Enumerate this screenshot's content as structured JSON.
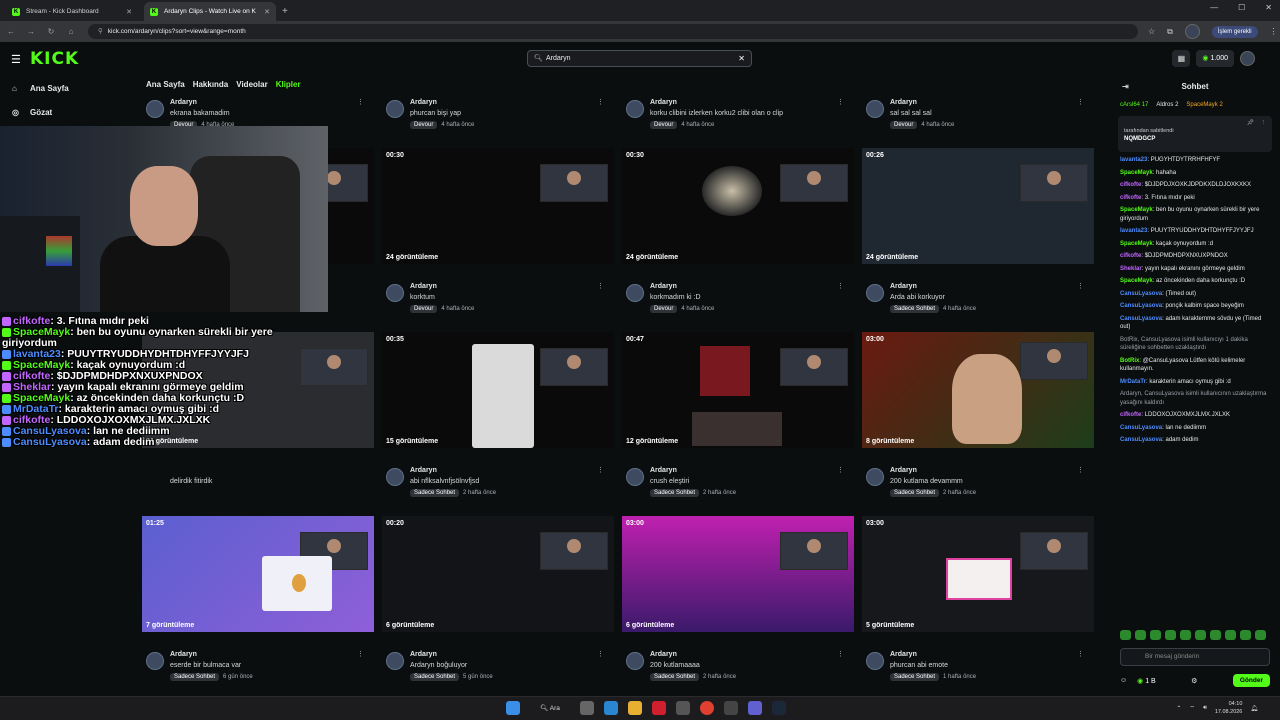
{
  "browser": {
    "tabs": [
      {
        "title": "Stream - Kick Dashboard"
      },
      {
        "title": "Ardaryn Clips - Watch Live on K"
      }
    ],
    "url": "kick.com/ardaryn/clips?sort=view&range=month",
    "update_label": "İşlem gerekli"
  },
  "header": {
    "logo": "KICK",
    "search_value": "Ardaryn",
    "kicks_count": "1.000"
  },
  "sidebar": {
    "items": [
      {
        "label": "Ana Sayfa",
        "icon": "home-icon"
      },
      {
        "label": "Gözat",
        "icon": "compass-icon"
      }
    ]
  },
  "channel_tabs": [
    "Ana Sayfa",
    "Hakkında",
    "Videolar",
    "Klipler"
  ],
  "clips_top_row": [
    {
      "author": "Ardaryn",
      "title": "ekrana bakamadim",
      "category": "Devour",
      "age": "4 hafta önce"
    },
    {
      "author": "Ardaryn",
      "title": "phurcan bişi yap",
      "category": "Devour",
      "age": "4 hafta önce"
    },
    {
      "author": "Ardaryn",
      "title": "korku clibini izlerken korku2 clibi olan o clip",
      "category": "Devour",
      "age": "4 hafta önce"
    },
    {
      "author": "Ardaryn",
      "title": "sal sal sal sal",
      "category": "Devour",
      "age": "4 hafta önce"
    }
  ],
  "clips": [
    [
      {
        "duration": "",
        "views": "",
        "author": "",
        "title": "",
        "category": "",
        "age": ""
      },
      {
        "duration": "00:30",
        "views": "24 görüntüleme",
        "author": "Ardaryn",
        "title": "korktum",
        "category": "Devour",
        "age": "4 hafta önce"
      },
      {
        "duration": "00:30",
        "views": "24 görüntüleme",
        "author": "Ardaryn",
        "title": "korkmadım ki :D",
        "category": "Devour",
        "age": "4 hafta önce"
      },
      {
        "duration": "00:26",
        "views": "24 görüntüleme",
        "author": "Ardaryn",
        "title": "Arda abi korkuyor",
        "category": "Sadece Sohbet",
        "age": "4 hafta önce"
      }
    ],
    [
      {
        "duration": "",
        "views": "23 görüntüleme",
        "author": "",
        "title": "delirdik fitirdik",
        "category": "",
        "age": ""
      },
      {
        "duration": "00:35",
        "views": "15 görüntüleme",
        "author": "Ardaryn",
        "title": "abi nflksalvnfjsölnvfjsd",
        "category": "Sadece Sohbet",
        "age": "2 hafta önce"
      },
      {
        "duration": "00:47",
        "views": "12 görüntüleme",
        "author": "Ardaryn",
        "title": "crush eleştiri",
        "category": "Sadece Sohbet",
        "age": "2 hafta önce"
      },
      {
        "duration": "03:00",
        "views": "8 görüntüleme",
        "author": "Ardaryn",
        "title": "200 kutlama devammm",
        "category": "Sadece Sohbet",
        "age": "2 hafta önce"
      }
    ],
    [
      {
        "duration": "01:25",
        "views": "7 görüntüleme",
        "author": "Ardaryn",
        "title": "eserde bir bulmaca var",
        "category": "Sadece Sohbet",
        "age": "6 gün önce"
      },
      {
        "duration": "00:20",
        "views": "6 görüntüleme",
        "author": "Ardaryn",
        "title": "Ardaryn boğuluyor",
        "category": "Sadece Sohbet",
        "age": "5 gün önce"
      },
      {
        "duration": "03:00",
        "views": "6 görüntüleme",
        "author": "Ardaryn",
        "title": "200 kutlamaaaa",
        "category": "Sadece Sohbet",
        "age": "2 hafta önce"
      },
      {
        "duration": "03:00",
        "views": "5 görüntüleme",
        "author": "Ardaryn",
        "title": "phurcan abi emote",
        "category": "Sadece Sohbet",
        "age": "1 hafta önce"
      }
    ]
  ],
  "chat": {
    "title": "Sohbet",
    "gifters": [
      {
        "name": "cArsl64",
        "count": "17"
      },
      {
        "name": "Aldros",
        "count": "2"
      },
      {
        "name": "SpaceMayk",
        "count": "2"
      }
    ],
    "pinned_by": "tarafından sabitlendi",
    "pinned_msg": "NQMDGCP",
    "messages": [
      {
        "user": "lavanta23",
        "color": "#4d8cff",
        "text": "PUGYHTDYTRRHFHFYF"
      },
      {
        "user": "SpaceMayk",
        "color": "#53fc18",
        "text": "hahaha"
      },
      {
        "user": "cifkofte",
        "color": "#c266ff",
        "text": "$DJDPDJXOXKJDPDKXDLDJOXKXKX"
      },
      {
        "user": "cifkofte",
        "color": "#c266ff",
        "text": "3. Fıtına mıdır peki"
      },
      {
        "user": "SpaceMayk",
        "color": "#53fc18",
        "text": "ben bu oyunu oynarken sürekli bir yere giriyordum"
      },
      {
        "user": "lavanta23",
        "color": "#4d8cff",
        "text": "PUUYTRYUDDHYDHTDHYFFJYYJFJ"
      },
      {
        "user": "SpaceMayk",
        "color": "#53fc18",
        "text": "kaçak oynuyordum :d"
      },
      {
        "user": "cifkofte",
        "color": "#c266ff",
        "text": "$DJDPMDHDPXNXUXPNDOX"
      },
      {
        "user": "Sheklar",
        "color": "#c266ff",
        "text": "yayın kapalı ekranını görmeye geldim"
      },
      {
        "user": "SpaceMayk",
        "color": "#53fc18",
        "text": "az öncekinden daha korkunçtu :D"
      },
      {
        "user": "CansuLyasova",
        "color": "#4d8cff",
        "text": "(Timed out)"
      },
      {
        "user": "CansuLyasova",
        "color": "#4d8cff",
        "text": "ponçik kalbim space beyeğim"
      },
      {
        "user": "CansuLyasova",
        "color": "#4d8cff",
        "text": "adam karakternme sövdu ye (Timed out)"
      },
      {
        "user": "",
        "color": "#9aa0a6",
        "text": "BotRix, CansuLyasova isimli kullanıcıyı 1 dakika süreliğine sohbetten uzaklaştırdı"
      },
      {
        "user": "BotRix",
        "color": "#53fc18",
        "text": "@CansuLyasova Lütfen kötü kelimeler kullanmayın."
      },
      {
        "user": "MrDataTr",
        "color": "#4d8cff",
        "text": "karakterin amacı oymuş gibi :d"
      },
      {
        "user": "",
        "color": "#9aa0a6",
        "text": "Ardaryn, CansuLyasova isimli kullanıcının uzaklaştırma yasağını kaldırdı"
      },
      {
        "user": "cifkofte",
        "color": "#c266ff",
        "text": "LDDOXOJXOXMXJLMX.JXLXK"
      },
      {
        "user": "CansuLyasova",
        "color": "#4d8cff",
        "text": "lan ne dediimm"
      },
      {
        "user": "CansuLyasova",
        "color": "#4d8cff",
        "text": "adam dedim"
      }
    ],
    "input_placeholder": "Bir mesaj gönderin",
    "points": "1 B",
    "send_label": "Gönder"
  },
  "overlay_chat": [
    {
      "user": "cifkofte",
      "color": "#c266ff",
      "text": ": 3. Fıtına mıdır peki"
    },
    {
      "user": "SpaceMayk",
      "color": "#53fc18",
      "text": ": ben bu oyunu oynarken sürekli bir yere"
    },
    {
      "user": "",
      "color": "#fff",
      "text": "giriyordum"
    },
    {
      "user": "lavanta23",
      "color": "#4d8cff",
      "text": ": PUUYTRYUDDHYDHTDHYFFJYYJFJ"
    },
    {
      "user": "SpaceMayk",
      "color": "#53fc18",
      "text": ": kaçak oynuyordum :d"
    },
    {
      "user": "cifkofte",
      "color": "#c266ff",
      "text": ": $DJDPMDHDPXNXUXPNDOX"
    },
    {
      "user": "Sheklar",
      "color": "#c266ff",
      "text": ": yayın kapalı ekranını görmeye geldim"
    },
    {
      "user": "SpaceMayk",
      "color": "#53fc18",
      "text": ": az öncekinden daha korkunçtu :D"
    },
    {
      "user": "MrDataTr",
      "color": "#4d8cff",
      "text": ": karakterin amacı oymuş gibi :d"
    },
    {
      "user": "cifkofte",
      "color": "#c266ff",
      "text": ": LDDOXOJXOXMXJLMX.JXLXK"
    },
    {
      "user": "CansuLyasova",
      "color": "#4d8cff",
      "text": ": lan ne dediimm"
    },
    {
      "user": "CansuLyasova",
      "color": "#4d8cff",
      "text": ": adam dedim"
    }
  ],
  "taskbar": {
    "search": "Ara",
    "time": "04:10",
    "date": "17.08.2026"
  }
}
